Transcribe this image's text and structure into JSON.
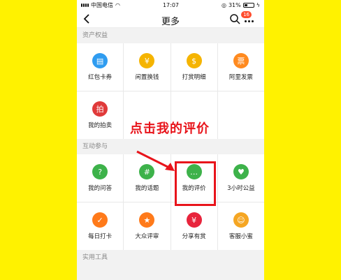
{
  "status": {
    "carrier": "中国电信",
    "time": "17:07",
    "battery": "31%"
  },
  "nav": {
    "title": "更多",
    "badge": "16"
  },
  "sections": [
    {
      "title": "资产权益",
      "items": [
        {
          "label": "红包卡券",
          "icon": "ticket-icon",
          "color": "#2f9cf0"
        },
        {
          "label": "闲置换钱",
          "icon": "yuan-coin-icon",
          "color": "#f5b400"
        },
        {
          "label": "打赏明细",
          "icon": "money-bag-icon",
          "color": "#f5b400"
        },
        {
          "label": "阿里发票",
          "icon": "invoice-icon",
          "color": "#ff8a1f"
        },
        {
          "label": "我的拍卖",
          "icon": "auction-icon",
          "color": "#e03a3a"
        }
      ]
    },
    {
      "title": "互动参与",
      "items": [
        {
          "label": "我的问答",
          "icon": "question-icon",
          "color": "#3db24a"
        },
        {
          "label": "我的话题",
          "icon": "hashtag-icon",
          "color": "#3db24a"
        },
        {
          "label": "我的评价",
          "icon": "comment-icon",
          "color": "#3db24a"
        },
        {
          "label": "3小时公益",
          "icon": "charity-icon",
          "color": "#3db24a"
        },
        {
          "label": "每日打卡",
          "icon": "calendar-check-icon",
          "color": "#ff7a1a"
        },
        {
          "label": "大众评审",
          "icon": "review-icon",
          "color": "#ff7a1a"
        },
        {
          "label": "分享有赏",
          "icon": "red-envelope-icon",
          "color": "#e8243c"
        },
        {
          "label": "客服小蜜",
          "icon": "service-icon",
          "color": "#f5a623"
        }
      ]
    },
    {
      "title": "实用工具",
      "items": []
    }
  ],
  "annotation": {
    "text": "点击我的评价",
    "color": "#e8141b"
  }
}
